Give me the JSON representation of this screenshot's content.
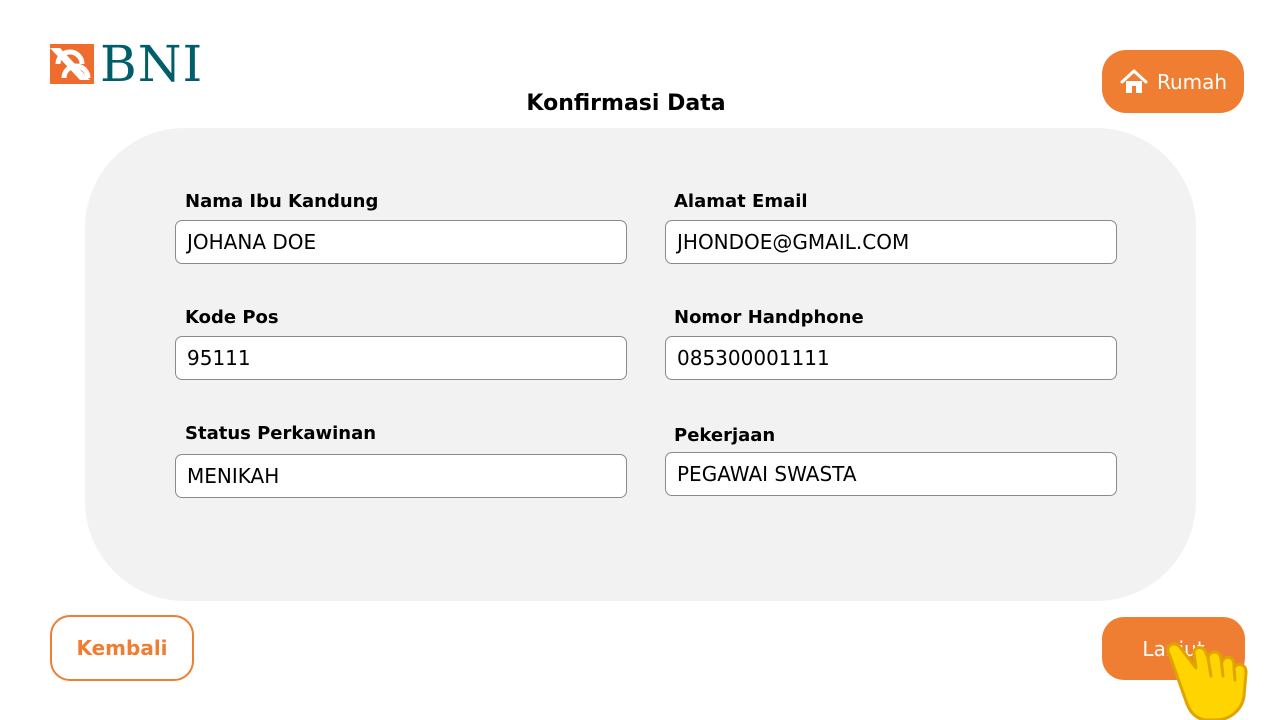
{
  "brand": {
    "logo_text": "BNI",
    "accent_color": "#ef7e32",
    "brand_color": "#005e6a"
  },
  "header": {
    "title": "Konfirmasi Data",
    "home_label": "Rumah",
    "home_icon": "home-icon"
  },
  "form": {
    "mother_name": {
      "label": "Nama Ibu Kandung",
      "value": "JOHANA DOE"
    },
    "email": {
      "label": "Alamat Email",
      "value": "JHONDOE@GMAIL.COM"
    },
    "postal_code": {
      "label": "Kode Pos",
      "value": "95111"
    },
    "phone": {
      "label": "Nomor Handphone",
      "value": "085300001111"
    },
    "marital_status": {
      "label": "Status Perkawinan",
      "value": "MENIKAH"
    },
    "occupation": {
      "label": "Pekerjaan",
      "value": "PEGAWAI SWASTA"
    }
  },
  "footer": {
    "back_label": "Kembali",
    "next_label": "Lanjut",
    "cursor_icon": "pointing-hand-icon"
  }
}
